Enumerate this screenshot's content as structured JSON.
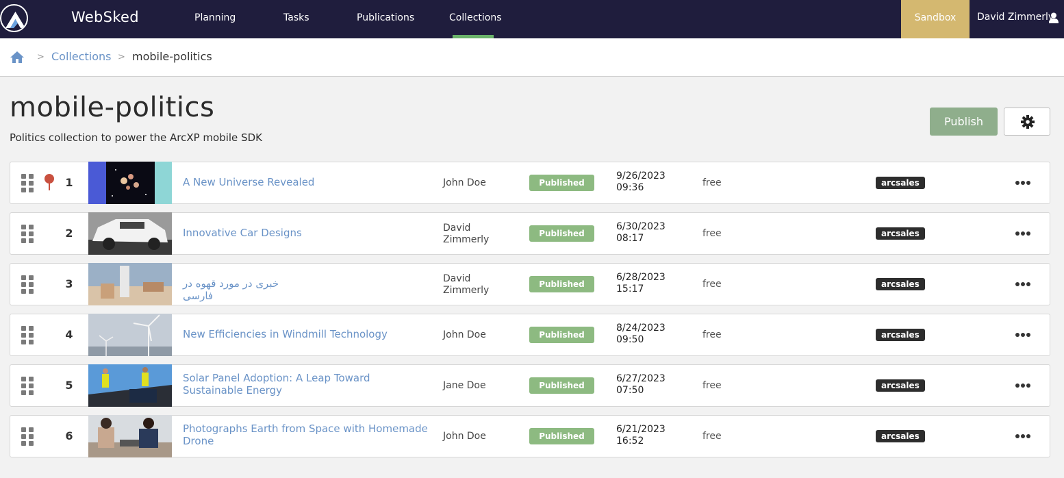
{
  "nav": {
    "app_name": "WebSked",
    "items": [
      {
        "label": "Planning"
      },
      {
        "label": "Tasks"
      },
      {
        "label": "Publications"
      },
      {
        "label": "Collections"
      }
    ],
    "active": "Collections",
    "environment": "Sandbox",
    "user": "David Zimmerly"
  },
  "breadcrumb": {
    "home_icon": "home-icon",
    "separator": ">",
    "link": "Collections",
    "current": "mobile-politics"
  },
  "header": {
    "title": "mobile-politics",
    "description": "Politics collection to power the ArcXP mobile SDK",
    "publish_label": "Publish",
    "settings_icon": "gear-icon"
  },
  "items": [
    {
      "rank": "1",
      "pinned": true,
      "thumb": "space-galaxy",
      "title": "A New Universe Revealed",
      "author": "John Doe",
      "status": "Published",
      "date": "9/26/2023",
      "time": "09:36",
      "access": "free",
      "tag": "arcsales"
    },
    {
      "rank": "2",
      "pinned": false,
      "thumb": "white-car",
      "title": "Innovative Car Designs",
      "author": "David Zimmerly",
      "status": "Published",
      "date": "6/30/2023",
      "time": "08:17",
      "access": "free",
      "tag": "arcsales"
    },
    {
      "rank": "3",
      "pinned": false,
      "thumb": "coffee-cups",
      "title": "خبری در مورد قهوه در فارسی",
      "author": "David Zimmerly",
      "status": "Published",
      "date": "6/28/2023",
      "time": "15:17",
      "access": "free",
      "tag": "arcsales"
    },
    {
      "rank": "4",
      "pinned": false,
      "thumb": "windmills",
      "title": "New Efficiencies in Windmill Technology",
      "author": "John Doe",
      "status": "Published",
      "date": "8/24/2023",
      "time": "09:50",
      "access": "free",
      "tag": "arcsales"
    },
    {
      "rank": "5",
      "pinned": false,
      "thumb": "solar-panels",
      "title": "Solar Panel Adoption: A Leap Toward Sustainable Energy",
      "author": "Jane Doe",
      "status": "Published",
      "date": "6/27/2023",
      "time": "07:50",
      "access": "free",
      "tag": "arcsales"
    },
    {
      "rank": "6",
      "pinned": false,
      "thumb": "students-drone",
      "title": "Photographs Earth from Space with Homemade Drone",
      "author": "John Doe",
      "status": "Published",
      "date": "6/21/2023",
      "time": "16:52",
      "access": "free",
      "tag": "arcsales"
    }
  ],
  "colors": {
    "nav_bg": "#1f1d3d",
    "sandbox": "#d4b870",
    "link": "#6a93c7",
    "published": "#8dba81",
    "publish_button": "#8fae8c",
    "active_underline": "#6ab26a"
  }
}
